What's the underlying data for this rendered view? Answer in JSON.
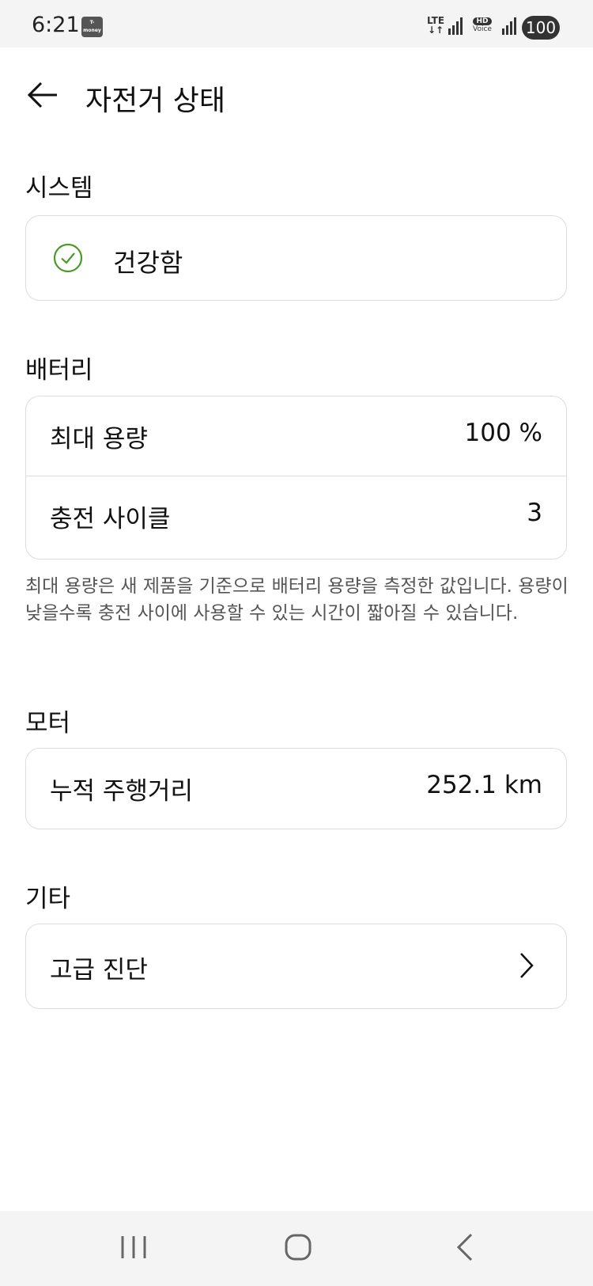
{
  "status_bar": {
    "time": "6:21",
    "app_icon_text": "T-money",
    "network": "LTE",
    "hd": "HD",
    "voice": "Voice",
    "battery": "100"
  },
  "header": {
    "title": "자전거 상태",
    "back_icon": "arrow-left-icon"
  },
  "system": {
    "section_title": "시스템",
    "status_label": "건강함",
    "status_icon": "check-circle-icon",
    "status_color": "#4a9a2a"
  },
  "battery": {
    "section_title": "배터리",
    "rows": [
      {
        "label": "최대 용량",
        "value": "100 %"
      },
      {
        "label": "충전 사이클",
        "value": "3"
      }
    ],
    "note": "최대 용량은 새 제품을 기준으로 배터리 용량을 측정한 값입니다. 용량이 낮을수록 충전 사이에 사용할 수 있는 시간이 짧아질 수 있습니다."
  },
  "motor": {
    "section_title": "모터",
    "rows": [
      {
        "label": "누적 주행거리",
        "value": "252.1 km"
      }
    ]
  },
  "other": {
    "section_title": "기타",
    "rows": [
      {
        "label": "고급 진단",
        "icon": "chevron-right-icon"
      }
    ]
  },
  "nav": {
    "recents_icon": "recents-icon",
    "home_icon": "home-icon",
    "back_icon": "back-icon"
  }
}
